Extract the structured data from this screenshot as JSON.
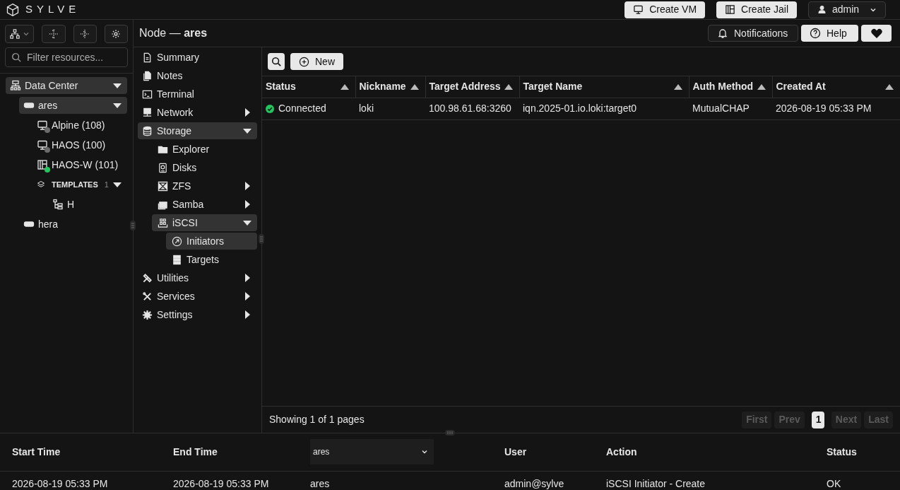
{
  "app": {
    "name": "SYLVE"
  },
  "top_buttons": [
    {
      "label": "Create VM",
      "kind": "vm"
    },
    {
      "label": "Create Jail",
      "kind": "jail"
    }
  ],
  "user_menu": {
    "label": "admin"
  },
  "sidebar": {
    "filter": {
      "placeholder": "Filter resources..."
    },
    "tree": [
      {
        "label": "Data Center",
        "kind": "datacenter",
        "selected": true,
        "expanded": true,
        "children": [
          {
            "label": "ares",
            "kind": "node",
            "selected": true,
            "expanded": true,
            "children": [
              {
                "label": "Alpine (108)",
                "kind": "vm",
                "selected": false,
                "color": "#6b6b6b"
              },
              {
                "label": "HAOS (100)",
                "kind": "vm",
                "selected": false,
                "color": "#6b6b6b"
              },
              {
                "label": "HAOS-W (101)",
                "kind": "jail",
                "selected": false,
                "color": "#22c55e"
              },
              {
                "label": "TEMPLATES",
                "kind": "group",
                "count": "1",
                "selected": false,
                "expanded": true,
                "children": [
                  {
                    "label": "H",
                    "kind": "template",
                    "selected": false
                  }
                ]
              }
            ]
          },
          {
            "label": "hera",
            "kind": "node",
            "selected": false
          }
        ]
      }
    ]
  },
  "header": {
    "title": "Node — **ares**",
    "buttons": [
      {
        "label": "Notifications",
        "kind": "bell"
      },
      {
        "label": "Help",
        "kind": "help"
      }
    ]
  },
  "nav": [
    {
      "label": "Summary",
      "kind": "summary",
      "selected": false
    },
    {
      "label": "Notes",
      "kind": "notes",
      "selected": false
    },
    {
      "label": "Terminal",
      "kind": "terminal",
      "selected": false
    },
    {
      "label": "Network",
      "kind": "network",
      "selected": false,
      "expanded": false
    },
    {
      "label": "Storage",
      "kind": "storage",
      "selected": true,
      "expanded": true,
      "children": [
        {
          "label": "Explorer",
          "kind": "folder",
          "selected": false
        },
        {
          "label": "Disks",
          "kind": "disk",
          "selected": false
        },
        {
          "label": "ZFS",
          "kind": "zfs",
          "selected": false,
          "expanded": false
        },
        {
          "label": "Samba",
          "kind": "samba",
          "selected": false,
          "expanded": false
        },
        {
          "label": "iSCSI",
          "kind": "iscsi",
          "selected": true,
          "expanded": true,
          "children": [
            {
              "label": "Initiators",
              "kind": "initiator",
              "selected": true
            },
            {
              "label": "Targets",
              "kind": "targets",
              "selected": false
            }
          ]
        }
      ]
    },
    {
      "label": "Utilities",
      "kind": "utilities",
      "selected": false,
      "expanded": false
    },
    {
      "label": "Services",
      "kind": "services",
      "selected": false,
      "expanded": false
    },
    {
      "label": "Settings",
      "kind": "settings",
      "selected": false,
      "expanded": false
    }
  ],
  "toolbar": {
    "new_button": "New"
  },
  "table": {
    "columns": [
      "Status",
      "Nickname",
      "Target Address",
      "Target Name",
      "Auth Method",
      "Created At"
    ],
    "rows": [
      {
        "connected": true,
        "cells": [
          "Connected",
          "loki",
          "100.98.61.68:3260",
          "iqn.2025-01.io.loki:target0",
          "MutualCHAP",
          "2026-08-19 05:33 PM"
        ]
      }
    ]
  },
  "pagination": {
    "summary": "Showing 1 of 1 pages",
    "buttons": [
      {
        "label": "First",
        "disabled": true,
        "selected": false
      },
      {
        "label": "Prev",
        "disabled": true,
        "selected": false
      },
      {
        "label": "1",
        "disabled": false,
        "selected": true
      },
      {
        "label": "Next",
        "disabled": true,
        "selected": false
      },
      {
        "label": "Last",
        "disabled": true,
        "selected": false
      }
    ]
  },
  "audit_log": {
    "columns": [
      {
        "kind": "text",
        "label": "Start Time"
      },
      {
        "kind": "text",
        "label": "End Time"
      },
      {
        "kind": "select",
        "value": "ares"
      },
      {
        "kind": "text",
        "label": "User"
      },
      {
        "kind": "text",
        "label": "Action"
      },
      {
        "kind": "text",
        "label": "Status"
      }
    ],
    "rows": [
      [
        "2026-08-19 05:33 PM",
        "2026-08-19 05:33 PM",
        "ares",
        "admin@sylve",
        "iSCSI Initiator - Create",
        "OK"
      ]
    ]
  }
}
